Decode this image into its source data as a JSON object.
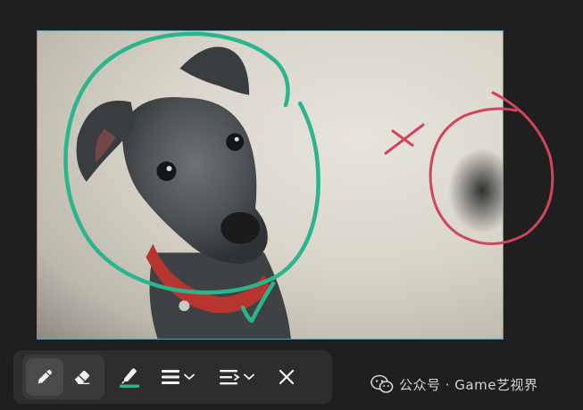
{
  "toolbar": {
    "tools": [
      {
        "name": "pen",
        "icon": "pencil-icon",
        "selected": true
      },
      {
        "name": "eraser",
        "icon": "eraser-icon",
        "selected": false
      },
      {
        "name": "highlighter",
        "icon": "highlighter-icon",
        "selected": false
      },
      {
        "name": "stroke-width",
        "icon": "line-weight-icon",
        "selected": false
      },
      {
        "name": "text-align",
        "icon": "align-icon",
        "selected": false
      },
      {
        "name": "close",
        "icon": "close-icon",
        "selected": false
      }
    ],
    "highlight_color": "#2bb38a"
  },
  "annotations": {
    "green_color": "#2bb58c",
    "red_color": "#d0445c"
  },
  "watermark": {
    "text": "公众号 · Game艺视界",
    "icon": "wechat-icon"
  }
}
